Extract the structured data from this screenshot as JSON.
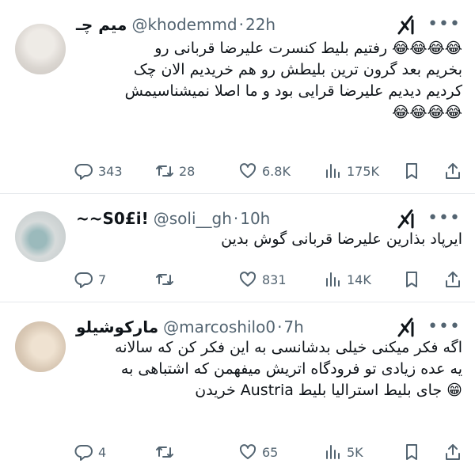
{
  "tweets": [
    {
      "display_name": "میم چـ",
      "handle": "@khodemmd",
      "time": "22h",
      "lines": [
        "😂😂😂😂 رفتیم بلیط کنسرت علیرضا قربانی رو",
        "بخریم  بعد گرون ترین بلیطش رو هم خریدیم الان چک",
        "کردیم دیدیم علیرضا قرایی بود و ما اصلا نمیشناسیمش",
        "😂😂😂😂"
      ],
      "replies": "343",
      "retweets": "28",
      "likes": "6.8K",
      "views": "175K"
    },
    {
      "display_name": "~~S0£i!",
      "handle": "@soli__gh",
      "time": "10h",
      "lines": [
        "ایرپاد بذارین علیرضا قربانی گوش بدین"
      ],
      "replies": "7",
      "retweets": "",
      "likes": "831",
      "views": "14K"
    },
    {
      "display_name": "مارکوشیلو",
      "handle": "@marcoshilo0",
      "time": "7h",
      "lines": [
        "اگه فکر میکنی خیلی بدشانسی به این فکر کن که سالانه",
        "یه عده زیادی تو فرودگاه اتریش میفهمن که اشتباهی به",
        "😁 جای بلیط استرالیا بلیط Austria خریدن"
      ],
      "replies": "4",
      "retweets": "",
      "likes": "65",
      "views": "5K"
    }
  ],
  "separator": "·",
  "icons": {
    "logo": "grok-logo-icon",
    "more": "more-dots-icon",
    "reply": "reply-icon",
    "retweet": "retweet-icon",
    "like": "heart-icon",
    "views": "views-icon",
    "bookmark": "bookmark-icon",
    "share": "share-icon"
  },
  "colors": {
    "text": "#0f1419",
    "muted": "#536471",
    "divider": "#e6e9ec"
  }
}
